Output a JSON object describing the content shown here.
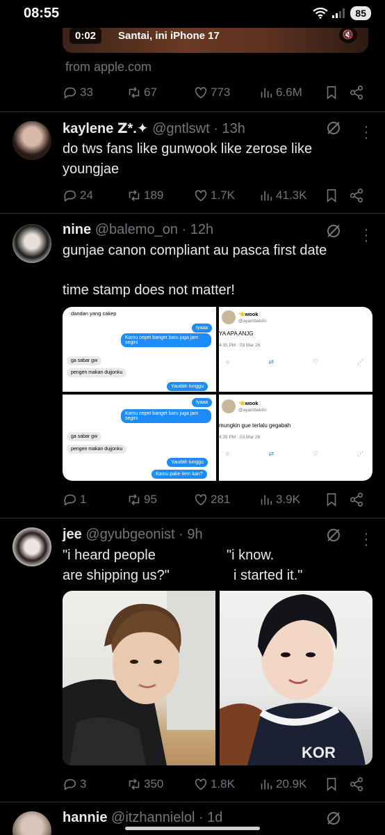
{
  "status_bar": {
    "time": "08:55",
    "battery": "85"
  },
  "quoted_card": {
    "video_time": "0:02",
    "video_title": "Santai, ini iPhone 17",
    "source": "from apple.com"
  },
  "tweet0_actions": {
    "replies": "33",
    "reposts": "67",
    "likes": "773",
    "views": "6.6M"
  },
  "tweets": [
    {
      "name": "kaylene ",
      "name_emoji": "ꓜ*.✦",
      "handle": "@gntlswt",
      "time": "13h",
      "text": "do tws fans like gunwook like zerose like youngjae",
      "replies": "24",
      "reposts": "189",
      "likes": "1.7K",
      "views": "41.3K"
    },
    {
      "name": "nine",
      "handle": "@balemo_on",
      "time": "12h",
      "text_line1": "gunjae canon compliant au pasca first date",
      "text_line2": "time stamp does not matter!",
      "replies": "1",
      "reposts": "95",
      "likes": "281",
      "views": "3.9K",
      "media": {
        "chat1": {
          "top": "dandan yang cakep",
          "out1": "Iyaaa",
          "out2": "Kamu cepet banget baru juga jam segini",
          "in1": "ga sabar gw",
          "in2": "pengen makan dujjonku",
          "out3": "Yaudah tunggu"
        },
        "post1": {
          "name": "👈wook",
          "handle": "@ayambatoto",
          "text": "YA APA ANJG",
          "time": "4:35 PM · 03 Mar 26"
        },
        "chat2": {
          "out1": "Iyaaa",
          "out2": "Kamu cepet banget baru juga jam segini",
          "in1": "ga sabar gw",
          "in2": "pengen makan dujjonku",
          "out3": "Yaudah tunggu",
          "out4": "Kamu pake item kan?"
        },
        "post2": {
          "name": "👈wook",
          "handle": "@ayambatoto",
          "text": "mungkin gue terlalu gegabah",
          "time": "4:35 PM · 03 Mar 26"
        }
      }
    },
    {
      "name": "jee",
      "handle": "@gyubgeonist",
      "time": "9h",
      "text_left_1": "\"i heard people",
      "text_left_2": "are shipping us?\"",
      "text_right_1": "\"i know.",
      "text_right_2": "i started it.\"",
      "replies": "3",
      "reposts": "350",
      "likes": "1.8K",
      "views": "20.9K",
      "jersey_text": "KOR"
    },
    {
      "name": "hannie",
      "handle": "@itzhannielol",
      "time": "1d"
    }
  ],
  "colors": {
    "background": "#000000",
    "text": "#e7e9ea",
    "muted": "#71767b",
    "divider": "#2f3336",
    "link": "#1d9bf0"
  },
  "icons": [
    "reply-icon",
    "repost-icon",
    "like-icon",
    "views-icon",
    "bookmark-icon",
    "share-icon",
    "grok-icon",
    "more-icon",
    "wifi-icon",
    "signal-icon",
    "mute-icon"
  ]
}
